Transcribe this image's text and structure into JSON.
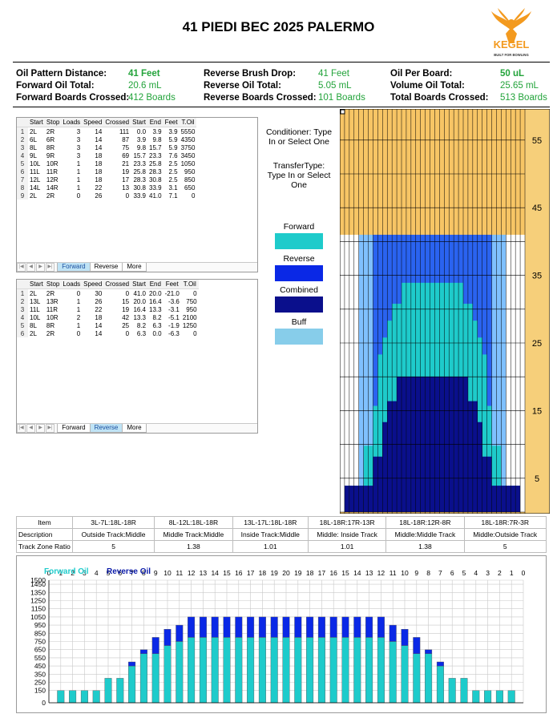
{
  "title": "41 PIEDI BEC 2025 PALERMO",
  "logo": {
    "text": "KEGEL",
    "tagline": "BUILT FOR BOWLING",
    "color": "#f39a1f"
  },
  "summary": {
    "oil_pattern_distance_label": "Oil Pattern Distance:",
    "oil_pattern_distance": "41 Feet",
    "reverse_brush_drop_label": "Reverse Brush Drop:",
    "reverse_brush_drop": "41 Feet",
    "oil_per_board_label": "Oil Per Board:",
    "oil_per_board": "50 uL",
    "forward_oil_total_label": "Forward Oil Total:",
    "forward_oil_total": "20.6 mL",
    "reverse_oil_total_label": "Reverse Oil Total:",
    "reverse_oil_total": "5.05 mL",
    "volume_oil_total_label": "Volume Oil Total:",
    "volume_oil_total": "25.65 mL",
    "forward_boards_crossed_label": "Forward Boards Crossed:",
    "forward_boards_crossed": "412 Boards",
    "reverse_boards_crossed_label": "Reverse Boards Crossed:",
    "reverse_boards_crossed": "101 Boards",
    "total_boards_crossed_label": "Total Boards Crossed:",
    "total_boards_crossed": "513 Boards"
  },
  "columns": [
    "Start",
    "Stop",
    "Loads",
    "Speed",
    "Crossed",
    "Start",
    "End",
    "Feet",
    "T.Oil"
  ],
  "forward_table": [
    [
      "1",
      "2L",
      "2R",
      "3",
      "14",
      "111",
      "0.0",
      "3.9",
      "3.9",
      "5550"
    ],
    [
      "2",
      "6L",
      "6R",
      "3",
      "14",
      "87",
      "3.9",
      "9.8",
      "5.9",
      "4350"
    ],
    [
      "3",
      "8L",
      "8R",
      "3",
      "14",
      "75",
      "9.8",
      "15.7",
      "5.9",
      "3750"
    ],
    [
      "4",
      "9L",
      "9R",
      "3",
      "18",
      "69",
      "15.7",
      "23.3",
      "7.6",
      "3450"
    ],
    [
      "5",
      "10L",
      "10R",
      "1",
      "18",
      "21",
      "23.3",
      "25.8",
      "2.5",
      "1050"
    ],
    [
      "6",
      "11L",
      "11R",
      "1",
      "18",
      "19",
      "25.8",
      "28.3",
      "2.5",
      "950"
    ],
    [
      "7",
      "12L",
      "12R",
      "1",
      "18",
      "17",
      "28.3",
      "30.8",
      "2.5",
      "850"
    ],
    [
      "8",
      "14L",
      "14R",
      "1",
      "22",
      "13",
      "30.8",
      "33.9",
      "3.1",
      "650"
    ],
    [
      "9",
      "2L",
      "2R",
      "0",
      "26",
      "0",
      "33.9",
      "41.0",
      "7.1",
      "0"
    ]
  ],
  "reverse_table": [
    [
      "1",
      "2L",
      "2R",
      "0",
      "30",
      "0",
      "41.0",
      "20.0",
      "-21.0",
      "0"
    ],
    [
      "2",
      "13L",
      "13R",
      "1",
      "26",
      "15",
      "20.0",
      "16.4",
      "-3.6",
      "750"
    ],
    [
      "3",
      "11L",
      "11R",
      "1",
      "22",
      "19",
      "16.4",
      "13.3",
      "-3.1",
      "950"
    ],
    [
      "4",
      "10L",
      "10R",
      "2",
      "18",
      "42",
      "13.3",
      "8.2",
      "-5.1",
      "2100"
    ],
    [
      "5",
      "8L",
      "8R",
      "1",
      "14",
      "25",
      "8.2",
      "6.3",
      "-1.9",
      "1250"
    ],
    [
      "6",
      "2L",
      "2R",
      "0",
      "14",
      "0",
      "6.3",
      "0.0",
      "-6.3",
      "0"
    ]
  ],
  "tabs": [
    "Forward",
    "Reverse",
    "More"
  ],
  "nav_glyphs": [
    "|◀",
    "◀",
    "▶",
    "▶|"
  ],
  "conditioner_text": "Conditioner: Type In or Select One",
  "transfer_text": "TransferType: Type In or Select One",
  "legend": [
    {
      "label": "Forward",
      "color": "#1ecbcb"
    },
    {
      "label": "Reverse",
      "color": "#0a28e6"
    },
    {
      "label": "Combined",
      "color": "#0a0f8c"
    },
    {
      "label": "Buff",
      "color": "#87cdea"
    }
  ],
  "lane_graph": {
    "feet_ticks": [
      "55",
      "45",
      "35",
      "25",
      "15",
      "5"
    ],
    "colors": {
      "dry": "#f7c565",
      "buff_light": "#7fc0ff",
      "reverse_area": "#2a63f0",
      "forward": "#1ecbcb",
      "combined": "#0a0f8c",
      "white": "#ffffff"
    }
  },
  "zone_table": {
    "row_labels": [
      "Item",
      "Description",
      "Track Zone Ratio"
    ],
    "items": [
      "3L-7L:18L-18R",
      "8L-12L:18L-18R",
      "13L-17L:18L-18R",
      "18L-18R:17R-13R",
      "18L-18R:12R-8R",
      "18L-18R:7R-3R"
    ],
    "descriptions": [
      "Outside Track:Middle",
      "Middle Track:Middle",
      "Inside Track:Middle",
      "Middle: Inside Track",
      "Middle:Middle Track",
      "Middle:Outside Track"
    ],
    "ratios": [
      "5",
      "1.38",
      "1.01",
      "1.01",
      "1.38",
      "5"
    ]
  },
  "chart_data": {
    "type": "bar",
    "stacked": true,
    "categories": [
      "1",
      "2",
      "3",
      "4",
      "5",
      "6",
      "7",
      "8",
      "9",
      "10",
      "11",
      "12",
      "13",
      "14",
      "15",
      "16",
      "17",
      "18",
      "19",
      "20",
      "21",
      "22",
      "23",
      "24",
      "25",
      "26",
      "27",
      "28",
      "29",
      "30",
      "31",
      "32",
      "33",
      "34",
      "35",
      "36",
      "37",
      "38",
      "39"
    ],
    "x_tick_labels": [
      "0",
      "1",
      "2",
      "3",
      "4",
      "5",
      "6",
      "7",
      "8",
      "9",
      "10",
      "11",
      "12",
      "13",
      "14",
      "15",
      "16",
      "17",
      "18",
      "19",
      "20",
      "19",
      "18",
      "17",
      "16",
      "15",
      "14",
      "13",
      "12",
      "11",
      "10",
      "9",
      "8",
      "7",
      "6",
      "5",
      "4",
      "3",
      "2",
      "1",
      "0"
    ],
    "series": [
      {
        "name": "Forward Oil",
        "color": "#1ecbcb",
        "values": [
          150,
          150,
          150,
          150,
          300,
          300,
          450,
          600,
          600,
          700,
          750,
          800,
          800,
          800,
          800,
          800,
          800,
          800,
          800,
          800,
          800,
          800,
          800,
          800,
          800,
          800,
          800,
          800,
          750,
          700,
          600,
          600,
          450,
          300,
          300,
          150,
          150,
          150,
          150
        ]
      },
      {
        "name": "Reverse Oil",
        "color": "#0a28e6",
        "values": [
          0,
          0,
          0,
          0,
          0,
          0,
          50,
          50,
          200,
          200,
          200,
          250,
          250,
          250,
          250,
          250,
          250,
          250,
          250,
          250,
          250,
          250,
          250,
          250,
          250,
          250,
          250,
          250,
          200,
          200,
          200,
          50,
          50,
          0,
          0,
          0,
          0,
          0,
          0
        ]
      }
    ],
    "ylim": [
      0,
      1500
    ],
    "yticks": [
      0,
      150,
      250,
      350,
      450,
      550,
      650,
      750,
      850,
      950,
      1050,
      1150,
      1250,
      1350,
      1450,
      1500
    ],
    "ytick_labels": [
      "0",
      "150",
      "250",
      "350",
      "450",
      "550",
      "650",
      "750",
      "850",
      "950",
      "1050",
      "1150",
      "1250",
      "1350",
      "1450",
      "1500"
    ],
    "grid": true,
    "legend": "top-left"
  }
}
